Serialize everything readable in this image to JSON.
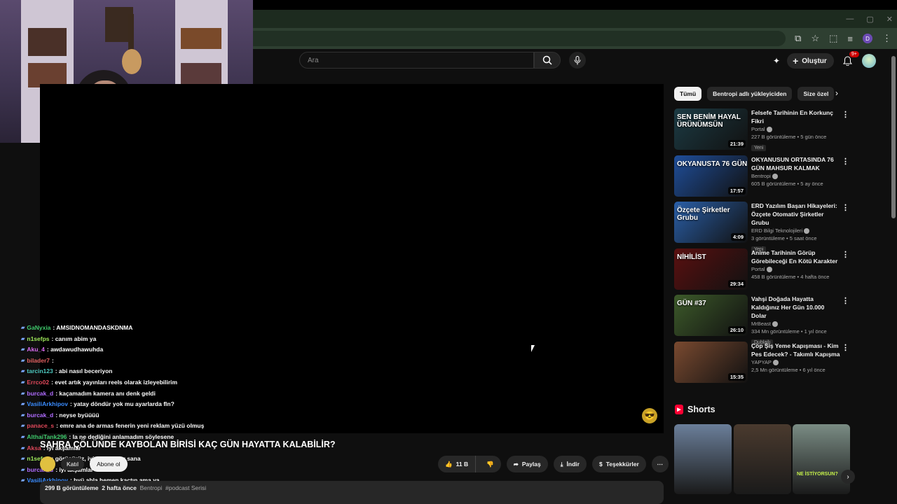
{
  "browser": {
    "window_controls": {
      "minimize": "—",
      "maximize": "▢",
      "close": "✕"
    },
    "toolbar_icons": [
      "screenshot-icon",
      "star-icon",
      "extensions-icon",
      "media-icon"
    ],
    "profile_letter": "D",
    "menu_icon": "⋮"
  },
  "header": {
    "search_placeholder": "Ara",
    "create_label": "Oluştur",
    "notifications_badge": "9+"
  },
  "chat": {
    "messages": [
      {
        "user": "GaNyxia",
        "text": ": AMSIDNOMANDASKDNMA",
        "color": "#3ec96b"
      },
      {
        "user": "n1sefps",
        "text": ": canım abim ya",
        "color": "#9ee85a"
      },
      {
        "user": "Aku_4",
        "text": ": awdawudhawuhda",
        "color": "#d86bf0"
      },
      {
        "user": "bilader7",
        "text": ":",
        "color": "#e06060"
      },
      {
        "user": "tarcin123",
        "text": ": abi nasıl beceriyon",
        "color": "#4ec9c0"
      },
      {
        "user": "Errco02",
        "text": ": evet artık yayınları reels olarak izleyebilirim",
        "color": "#e0485a"
      },
      {
        "user": "burcak_d",
        "text": ": kaçamadım kamera anı denk geldi",
        "color": "#b06cff"
      },
      {
        "user": "VasiliArkhipov",
        "text": ": yatay döndür yok mu ayarlarda fln?",
        "color": "#3a8cff"
      },
      {
        "user": "burcak_d",
        "text": ": neyse byüüüü",
        "color": "#b06cff"
      },
      {
        "user": "panace_s",
        "text": ": emre ana de armas fenerin yeni reklam yüzü olmuş",
        "color": "#e0485a"
      },
      {
        "user": "AlthaiTank296",
        "text": ": la ne dediğini anlamadım söylesene",
        "color": "#3ec96b"
      },
      {
        "user": "Aksa",
        "text": ": iyi akşamlar",
        "color": "#e0485a"
      },
      {
        "user": "n1sefps",
        "text": ": görüşürüz, iyi eğlenceler sana",
        "color": "#9ee85a"
      },
      {
        "user": "burcak_d",
        "text": ": iyi akşamlar",
        "color": "#b06cff"
      },
      {
        "user": "VasiliArkhipov",
        "text": ": byü abla hemen kaçtın ama ya",
        "color": "#3a8cff"
      }
    ]
  },
  "video": {
    "title": "SAHRA ÇÖLÜNDE KAYBOLAN BİRİSİ KAÇ GÜN HAYATTA KALABİLİR?",
    "join_label": "Katıl",
    "subscribe_label": "Abone ol",
    "likes": "11 B",
    "share_label": "Paylaş",
    "download_label": "İndir",
    "thanks_label": "Teşekkürler",
    "views": "299 B görüntüleme",
    "age": "2 hafta önce",
    "channel_tag": "Bentropi",
    "hashtag": "#podcast Serisi"
  },
  "filters": {
    "chips": [
      "Tümü",
      "Bentropi adlı yükleyiciden",
      "Size özel"
    ],
    "active_index": 0
  },
  "recommendations": [
    {
      "title": "Felsefe Tarihinin En Korkunç Fikri",
      "channel": "Portal",
      "views": "227 B görüntüleme",
      "age": "5 gün önce",
      "duration": "21:39",
      "badge": "Yeni",
      "thumb_text": "SEN BENİM HAYAL ÜRÜNÜMSÜN",
      "thumb_color": "#1c3b44"
    },
    {
      "title": "OKYANUSUN ORTASINDA 76 GÜN MAHSUR KALMAK",
      "channel": "Bentropi",
      "views": "605 B görüntüleme",
      "age": "5 ay önce",
      "duration": "17:57",
      "badge": "",
      "thumb_text": "OKYANUSTA 76 GÜN",
      "thumb_color": "#1f4e9a"
    },
    {
      "title": "ERD Yazılım Başarı Hikayeleri: Özçete Otomativ Şirketler Grubu",
      "channel": "ERD Bilgi Teknolojileri",
      "views": "3 görüntüleme",
      "age": "5 saat önce",
      "duration": "4:09",
      "badge": "Yeni",
      "thumb_text": "Özçete Şirketler Grubu",
      "thumb_color": "#2a5fa8"
    },
    {
      "title": "Anime Tarihinin Görüp Görebileceği En Kötü Karakter",
      "channel": "Portal",
      "views": "458 B görüntüleme",
      "age": "4 hafta önce",
      "duration": "29:34",
      "badge": "",
      "thumb_text": "NİHİLİST",
      "thumb_color": "#5a1010"
    },
    {
      "title": "Vahşi Doğada Hayatta Kaldığınız Her Gün 10.000 Dolar",
      "channel": "MrBeast",
      "views": "334 Mn görüntüleme",
      "age": "1 yıl önce",
      "duration": "26:10",
      "badge": "Dublajlı",
      "thumb_text": "GÜN #37",
      "thumb_color": "#3d5a2a"
    },
    {
      "title": "Çöp Şiş Yeme Kapışması - Kim Pes Edecek? - Takımlı Kapışma",
      "channel": "YAPYAP",
      "views": "2,5 Mn görüntüleme",
      "age": "6 yıl önce",
      "duration": "15:35",
      "badge": "",
      "thumb_text": "",
      "thumb_color": "#7a4a30"
    }
  ],
  "shorts": {
    "heading": "Shorts",
    "items": [
      {
        "color": "#6b7f9a"
      },
      {
        "color": "#4a3a2e"
      },
      {
        "color": "#7a8c84",
        "overlay": "NE İSTİYORSUN?"
      }
    ]
  }
}
